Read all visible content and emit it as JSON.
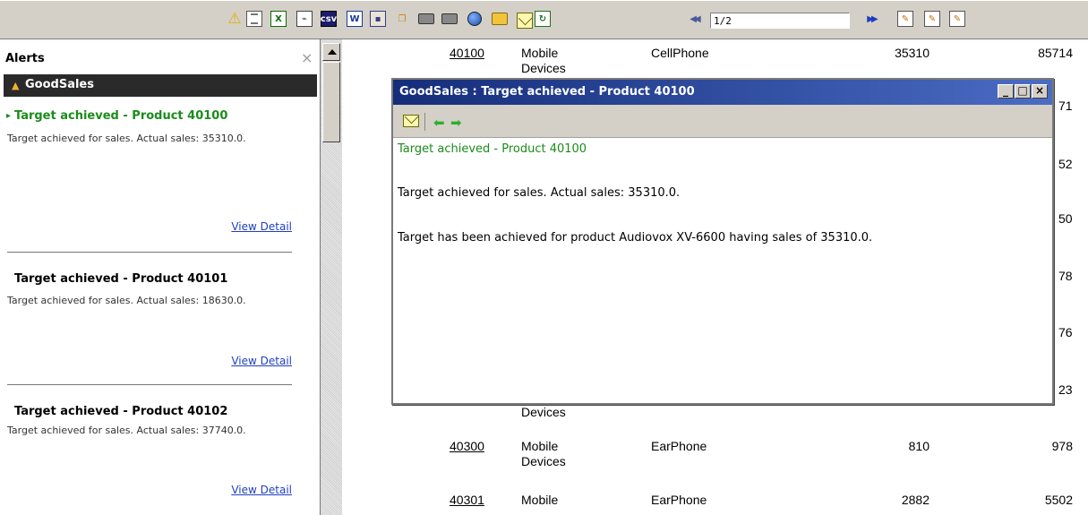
{
  "toolbar": {
    "icons": [
      "warning-icon",
      "view-icon",
      "excel-icon",
      "pdf-icon",
      "csv-icon",
      "word-icon",
      "xml-icon",
      "ppt-icon",
      "print-icon",
      "print-preview-icon",
      "globe-icon",
      "folder-icon",
      "mail-icon",
      "refresh-icon",
      "first-page-icon",
      "last-page-icon",
      "edit-icon",
      "edit-2-icon",
      "edit-3-icon"
    ],
    "csv_label": "csv",
    "page_value": "1/2"
  },
  "alerts": {
    "title": "Alerts",
    "group": "GoodSales",
    "items": [
      {
        "title": "Target achieved - Product 40100",
        "text": "Target achieved for sales. Actual sales: 35310.0.",
        "link": "View Detail"
      },
      {
        "title": "Target achieved - Product 40101",
        "text": "Target achieved for sales. Actual sales: 18630.0.",
        "link": "View Detail"
      },
      {
        "title": "Target achieved - Product 40102",
        "text": "Target achieved for sales. Actual sales: 37740.0.",
        "link": "View Detail"
      }
    ]
  },
  "table": {
    "rows": [
      {
        "id": "40100",
        "category": "Mobile Devices",
        "product": "CellPhone",
        "sales": "35310",
        "target": "85714"
      },
      {
        "id": "40300",
        "category": "Mobile Devices",
        "product": "EarPhone",
        "sales": "810",
        "target": "978"
      },
      {
        "id": "40301",
        "category": "Mobile",
        "product": "EarPhone",
        "sales": "2882",
        "target": "5502"
      }
    ],
    "fragments": [
      "71",
      "52",
      "50",
      "78",
      "76",
      "23",
      "Devices"
    ]
  },
  "popup": {
    "title": "GoodSales : Target achieved - Product 40100",
    "heading": "Target achieved - Product 40100",
    "line1": "Target achieved for sales. Actual sales: 35310.0.",
    "line2": "Target has been achieved for product Audiovox XV-6600 having sales of 35310.0.",
    "minimize": "_",
    "maximize": "□",
    "close": "×"
  },
  "colors": {
    "accent_green": "#1a8c1a",
    "link_blue": "#1f3fbf",
    "titlebar": "#152d7a"
  }
}
